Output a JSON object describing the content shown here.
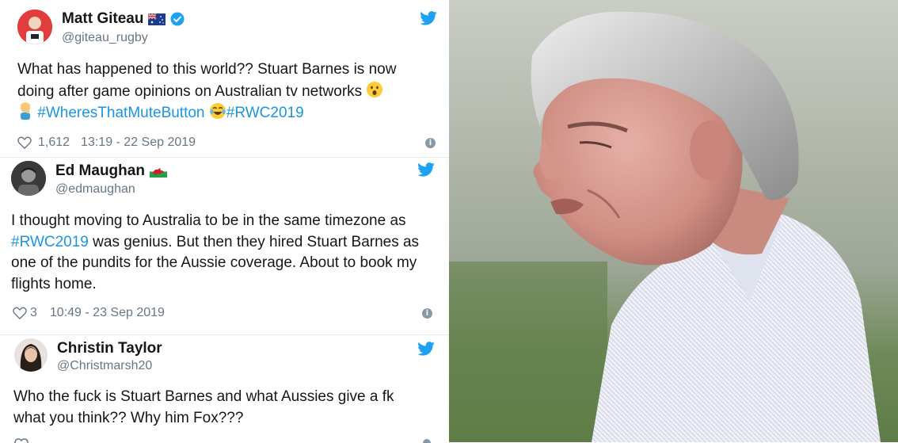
{
  "tweets": [
    {
      "name": "Matt Giteau",
      "handle": "@giteau_rugby",
      "flag": "australia-flag",
      "verified": true,
      "text_1": "What has happened to this world?? Stuart Barnes is now doing after game opinions on Australian tv networks",
      "hashtag_1": "#WheresThatMuteButton",
      "hashtag_2": "#RWC2019",
      "likes": "1,612",
      "timestamp": "13:19 - 22 Sep 2019"
    },
    {
      "name": "Ed Maughan",
      "handle": "@edmaughan",
      "flag": "wales-flag",
      "text_before": "I thought moving to Australia to be in the same timezone as",
      "hashtag": "#RWC2019",
      "text_after": "was genius. But then they hired Stuart Barnes as one of the pundits for the Aussie coverage. About to book my flights home.",
      "likes": "3",
      "timestamp": "10:49 - 23 Sep 2019"
    },
    {
      "name": "Christin Taylor",
      "handle": "@Christmarsh20",
      "text": "Who the fuck is Stuart Barnes and what Aussies give a fk what you think?? Why him Fox???"
    }
  ],
  "colors": {
    "link": "#1b95e0",
    "twitter_blue": "#1da1f2",
    "meta_gray": "#657786"
  }
}
